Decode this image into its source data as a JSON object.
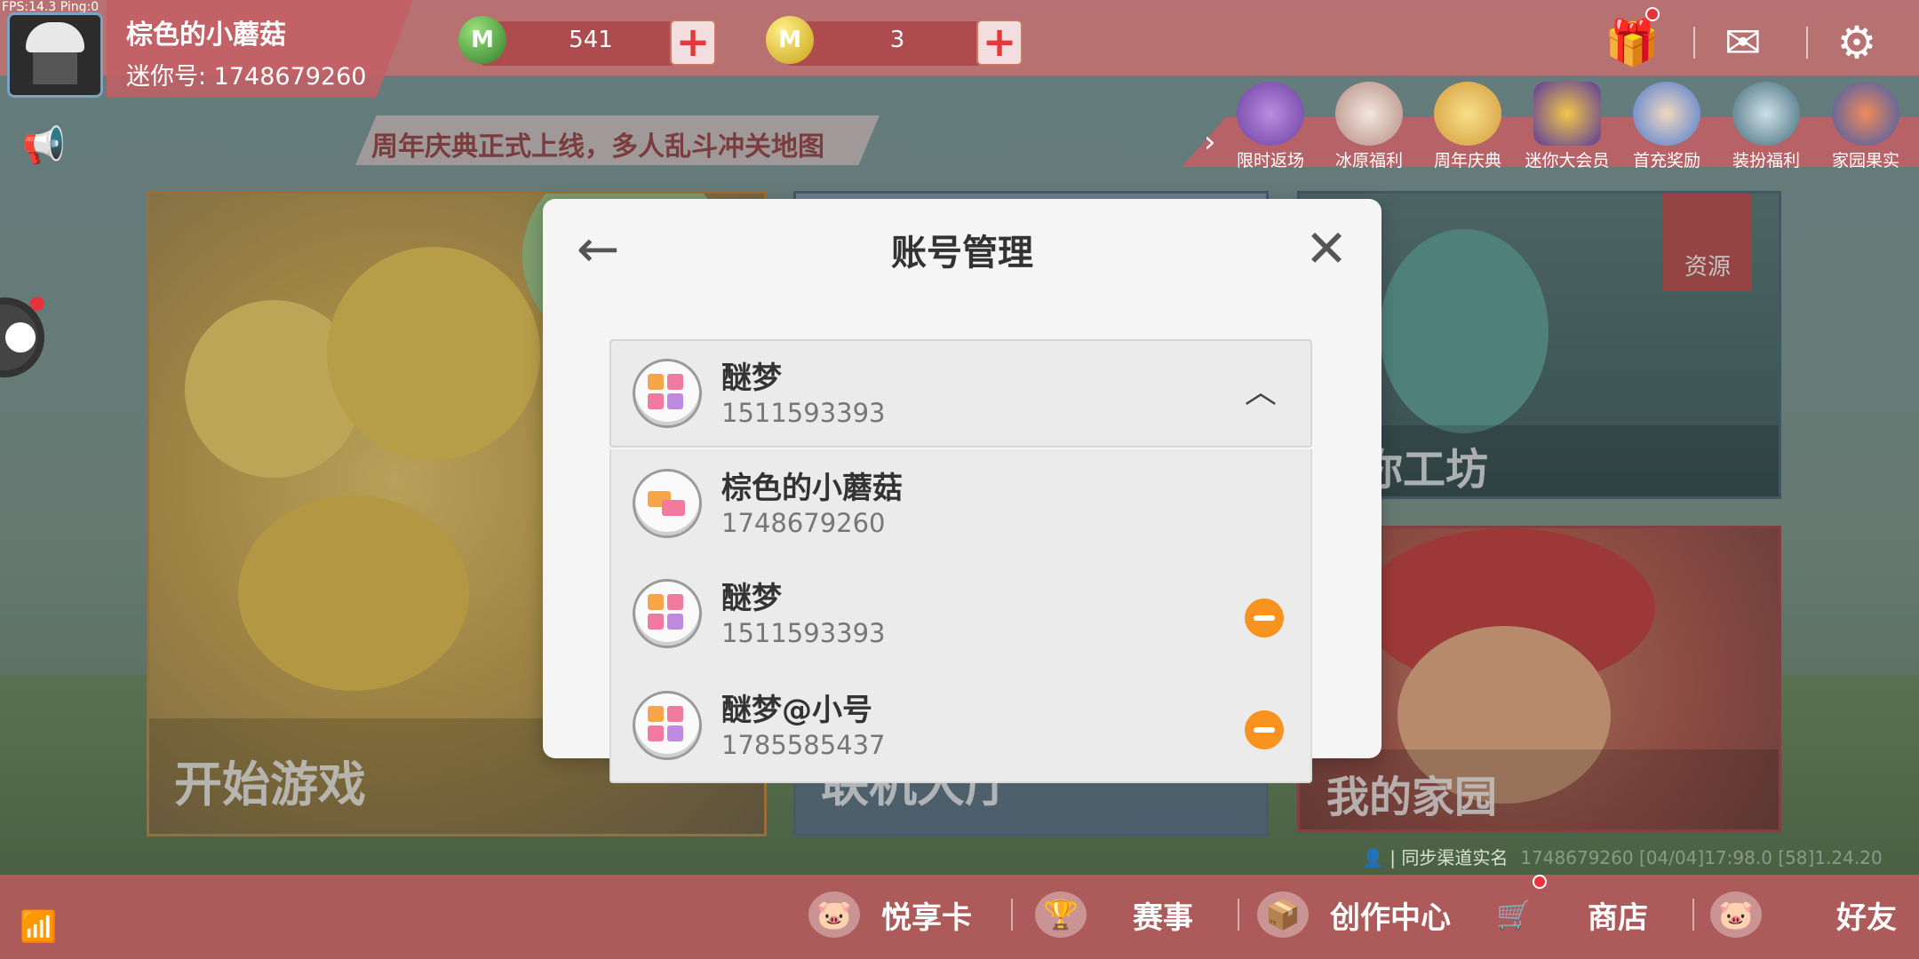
{
  "status": {
    "fps": "FPS:14.3  Ping:0"
  },
  "profile": {
    "nickname": "棕色的小蘑菇",
    "mini_id": "迷你号: 1748679260"
  },
  "currency": {
    "mini_coins": "541",
    "mini_beans": "3",
    "green_coin_letter": "M",
    "gold_coin_letter": "M",
    "plus": "+"
  },
  "top_icons": {
    "gift": "gift-icon",
    "mail": "mail-icon",
    "settings": "gear-icon"
  },
  "announcement": "周年庆典正式上线，多人乱斗冲关地图",
  "events": [
    "限时返场",
    "冰原福利",
    "周年庆典",
    "迷你大会员",
    "首充奖励",
    "装扮福利",
    "家园果实"
  ],
  "cards": {
    "start_game": "开始游戏",
    "online_hall": "联机大厅",
    "workshop": "迷你工坊",
    "home": "我的家园",
    "resource_tag": "资源"
  },
  "sync": {
    "label": "同步渠道实名",
    "ghost": "1748679260  [04/04]17:98.0  [58]1.24.20"
  },
  "bottom_nav": [
    "悦享卡",
    "赛事",
    "创作中心",
    "商店",
    "好友"
  ],
  "modal": {
    "title": "账号管理",
    "back_icon": "←",
    "close_icon": "✕",
    "selected_account": {
      "name": "醚梦",
      "id": "1511593393"
    },
    "accounts": [
      {
        "name": "棕色的小蘑菇",
        "id": "1748679260",
        "removable": false
      },
      {
        "name": "醚梦",
        "id": "1511593393",
        "removable": true
      },
      {
        "name": "醚梦@小号",
        "id": "1785585437",
        "removable": true
      }
    ]
  },
  "colors": {
    "accent_orange": "#f7931e",
    "topbar": "#d06e6e",
    "modal_bg": "#f5f5f5"
  }
}
